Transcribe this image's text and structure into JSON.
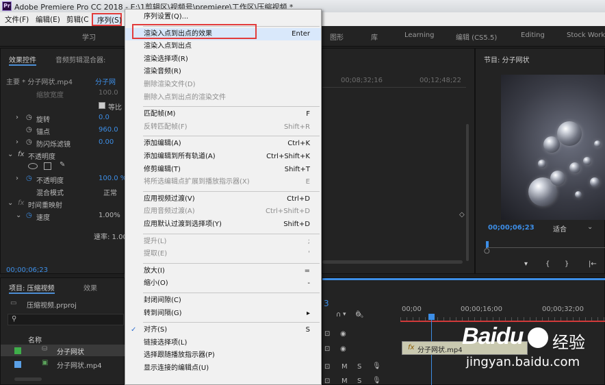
{
  "app": {
    "badge": "Pr",
    "title": "Adobe Premiere Pro CC 2018 - E:\\1剪辑区\\视频号\\premiere\\工作区\\压缩视频 *"
  },
  "menubar": [
    "文件(F)",
    "编辑(E)",
    "剪辑(C",
    "序列(S)"
  ],
  "workspaces": [
    "学习",
    "图形",
    "库",
    "Learning",
    "编辑 (CS5.5)",
    "Editing",
    "Stock Work"
  ],
  "effects_panel": {
    "tabs": [
      "效果控件",
      "音频剪辑混合器:"
    ],
    "master_label": "主要 * 分子网状.mp4",
    "master_seq": "分子网",
    "rows": [
      {
        "label": "缩放宽度",
        "value": "100.0"
      },
      {
        "label": "等比",
        "value": ""
      },
      {
        "label": "旋转",
        "value": "0.0"
      },
      {
        "label": "锚点",
        "value": "960.0"
      },
      {
        "label": "防闪烁滤镜",
        "value": "0.00"
      },
      {
        "label": "不透明度",
        "value": ""
      },
      {
        "label": "不透明度",
        "value": "100.0 %"
      },
      {
        "label": "混合模式",
        "value": "正常"
      },
      {
        "label": "时间重映射",
        "value": ""
      },
      {
        "label": "速度",
        "value": "1.00%"
      },
      {
        "label": "速率: 1.00",
        "value": ""
      }
    ],
    "timecode": "00;00;06;23"
  },
  "timeline_top": {
    "tc1": "00;08;32;16",
    "tc2": "00;12;48;22"
  },
  "program": {
    "title": "节目: 分子网状",
    "timecode": "00;00;06;23",
    "fit": "适合"
  },
  "project": {
    "tabs": [
      "项目: 压缩视频",
      "效果"
    ],
    "file": "压缩视频.prproj",
    "col_name": "名称",
    "items": [
      {
        "name": "分子网状",
        "color": "#3fae4a"
      },
      {
        "name": "分子网状.mp4",
        "color": "#5aa0e6"
      }
    ]
  },
  "timeline": {
    "marker": "3",
    "tcs": [
      "00;00",
      "00;00;16;00",
      "00;00;32;00"
    ],
    "clip": "分子网状.mp4",
    "track_btns": [
      "M",
      "S"
    ]
  },
  "menu": {
    "items": [
      {
        "label": "序列设置(Q)...",
        "sc": "",
        "dis": false
      },
      {
        "sep": true
      },
      {
        "label": "渲染入点到出点的效果",
        "sc": "Enter",
        "dis": false,
        "hl": true
      },
      {
        "label": "渲染入点到出点",
        "sc": "",
        "dis": false
      },
      {
        "label": "渲染选择项(R)",
        "sc": "",
        "dis": false
      },
      {
        "label": "渲染音频(R)",
        "sc": "",
        "dis": false
      },
      {
        "label": "删除渲染文件(D)",
        "sc": "",
        "dis": true
      },
      {
        "label": "删除入点到出点的渲染文件",
        "sc": "",
        "dis": true
      },
      {
        "sep": true
      },
      {
        "label": "匹配帧(M)",
        "sc": "F",
        "dis": false
      },
      {
        "label": "反转匹配帧(F)",
        "sc": "Shift+R",
        "dis": true
      },
      {
        "sep": true
      },
      {
        "label": "添加编辑(A)",
        "sc": "Ctrl+K",
        "dis": false
      },
      {
        "label": "添加编辑到所有轨道(A)",
        "sc": "Ctrl+Shift+K",
        "dis": false
      },
      {
        "label": "修剪编辑(T)",
        "sc": "Shift+T",
        "dis": false
      },
      {
        "label": "将所选编辑点扩展到播放指示器(X)",
        "sc": "E",
        "dis": true
      },
      {
        "sep": true
      },
      {
        "label": "应用视频过渡(V)",
        "sc": "Ctrl+D",
        "dis": false
      },
      {
        "label": "应用音频过渡(A)",
        "sc": "Ctrl+Shift+D",
        "dis": true
      },
      {
        "label": "应用默认过渡到选择项(Y)",
        "sc": "Shift+D",
        "dis": false
      },
      {
        "sep": true
      },
      {
        "label": "提升(L)",
        "sc": ";",
        "dis": true
      },
      {
        "label": "提取(E)",
        "sc": "'",
        "dis": true
      },
      {
        "sep": true
      },
      {
        "label": "放大(I)",
        "sc": "=",
        "dis": false
      },
      {
        "label": "缩小(O)",
        "sc": "-",
        "dis": false
      },
      {
        "sep": true
      },
      {
        "label": "封闭间隙(C)",
        "sc": "",
        "dis": false
      },
      {
        "label": "转到间隔(G)",
        "sc": "▸",
        "dis": false
      },
      {
        "sep": true
      },
      {
        "label": "对齐(S)",
        "sc": "S",
        "dis": false,
        "check": "✓"
      },
      {
        "label": "链接选择项(L)",
        "sc": "",
        "dis": false
      },
      {
        "label": "选择跟随播放指示器(P)",
        "sc": "",
        "dis": false
      },
      {
        "label": "显示连接的编辑点(U)",
        "sc": "",
        "dis": false
      }
    ]
  },
  "watermark": {
    "brand": "Baidu",
    "suffix": "经验",
    "url": "jingyan.baidu.com"
  }
}
